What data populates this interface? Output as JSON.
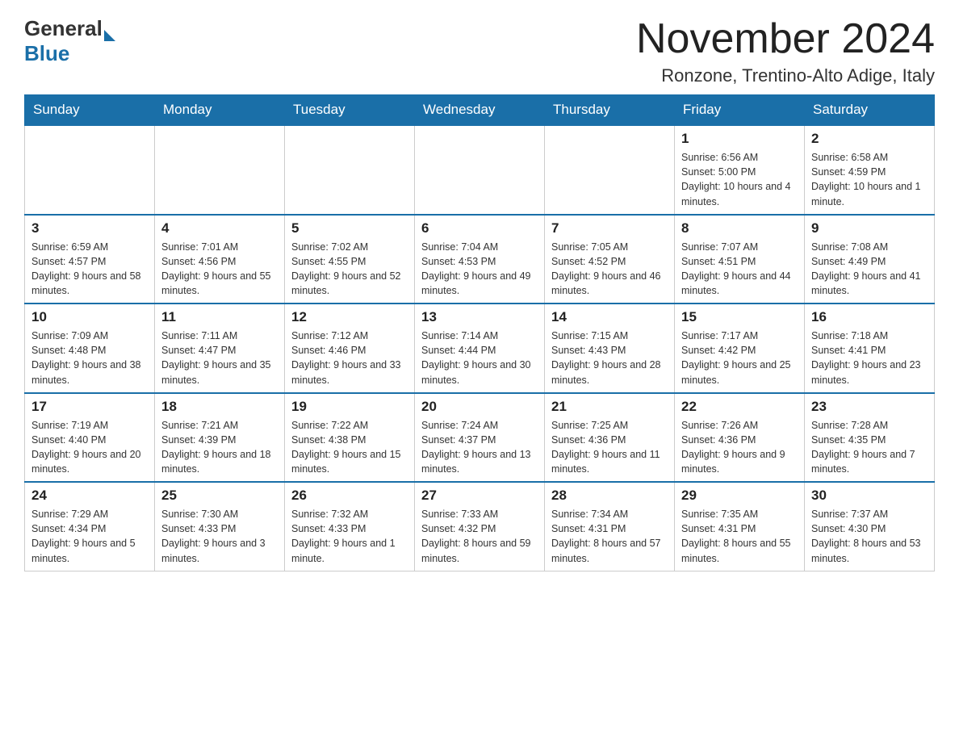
{
  "logo": {
    "general": "General",
    "blue": "Blue"
  },
  "title": "November 2024",
  "location": "Ronzone, Trentino-Alto Adige, Italy",
  "days_of_week": [
    "Sunday",
    "Monday",
    "Tuesday",
    "Wednesday",
    "Thursday",
    "Friday",
    "Saturday"
  ],
  "weeks": [
    [
      {
        "day": "",
        "info": ""
      },
      {
        "day": "",
        "info": ""
      },
      {
        "day": "",
        "info": ""
      },
      {
        "day": "",
        "info": ""
      },
      {
        "day": "",
        "info": ""
      },
      {
        "day": "1",
        "info": "Sunrise: 6:56 AM\nSunset: 5:00 PM\nDaylight: 10 hours and 4 minutes."
      },
      {
        "day": "2",
        "info": "Sunrise: 6:58 AM\nSunset: 4:59 PM\nDaylight: 10 hours and 1 minute."
      }
    ],
    [
      {
        "day": "3",
        "info": "Sunrise: 6:59 AM\nSunset: 4:57 PM\nDaylight: 9 hours and 58 minutes."
      },
      {
        "day": "4",
        "info": "Sunrise: 7:01 AM\nSunset: 4:56 PM\nDaylight: 9 hours and 55 minutes."
      },
      {
        "day": "5",
        "info": "Sunrise: 7:02 AM\nSunset: 4:55 PM\nDaylight: 9 hours and 52 minutes."
      },
      {
        "day": "6",
        "info": "Sunrise: 7:04 AM\nSunset: 4:53 PM\nDaylight: 9 hours and 49 minutes."
      },
      {
        "day": "7",
        "info": "Sunrise: 7:05 AM\nSunset: 4:52 PM\nDaylight: 9 hours and 46 minutes."
      },
      {
        "day": "8",
        "info": "Sunrise: 7:07 AM\nSunset: 4:51 PM\nDaylight: 9 hours and 44 minutes."
      },
      {
        "day": "9",
        "info": "Sunrise: 7:08 AM\nSunset: 4:49 PM\nDaylight: 9 hours and 41 minutes."
      }
    ],
    [
      {
        "day": "10",
        "info": "Sunrise: 7:09 AM\nSunset: 4:48 PM\nDaylight: 9 hours and 38 minutes."
      },
      {
        "day": "11",
        "info": "Sunrise: 7:11 AM\nSunset: 4:47 PM\nDaylight: 9 hours and 35 minutes."
      },
      {
        "day": "12",
        "info": "Sunrise: 7:12 AM\nSunset: 4:46 PM\nDaylight: 9 hours and 33 minutes."
      },
      {
        "day": "13",
        "info": "Sunrise: 7:14 AM\nSunset: 4:44 PM\nDaylight: 9 hours and 30 minutes."
      },
      {
        "day": "14",
        "info": "Sunrise: 7:15 AM\nSunset: 4:43 PM\nDaylight: 9 hours and 28 minutes."
      },
      {
        "day": "15",
        "info": "Sunrise: 7:17 AM\nSunset: 4:42 PM\nDaylight: 9 hours and 25 minutes."
      },
      {
        "day": "16",
        "info": "Sunrise: 7:18 AM\nSunset: 4:41 PM\nDaylight: 9 hours and 23 minutes."
      }
    ],
    [
      {
        "day": "17",
        "info": "Sunrise: 7:19 AM\nSunset: 4:40 PM\nDaylight: 9 hours and 20 minutes."
      },
      {
        "day": "18",
        "info": "Sunrise: 7:21 AM\nSunset: 4:39 PM\nDaylight: 9 hours and 18 minutes."
      },
      {
        "day": "19",
        "info": "Sunrise: 7:22 AM\nSunset: 4:38 PM\nDaylight: 9 hours and 15 minutes."
      },
      {
        "day": "20",
        "info": "Sunrise: 7:24 AM\nSunset: 4:37 PM\nDaylight: 9 hours and 13 minutes."
      },
      {
        "day": "21",
        "info": "Sunrise: 7:25 AM\nSunset: 4:36 PM\nDaylight: 9 hours and 11 minutes."
      },
      {
        "day": "22",
        "info": "Sunrise: 7:26 AM\nSunset: 4:36 PM\nDaylight: 9 hours and 9 minutes."
      },
      {
        "day": "23",
        "info": "Sunrise: 7:28 AM\nSunset: 4:35 PM\nDaylight: 9 hours and 7 minutes."
      }
    ],
    [
      {
        "day": "24",
        "info": "Sunrise: 7:29 AM\nSunset: 4:34 PM\nDaylight: 9 hours and 5 minutes."
      },
      {
        "day": "25",
        "info": "Sunrise: 7:30 AM\nSunset: 4:33 PM\nDaylight: 9 hours and 3 minutes."
      },
      {
        "day": "26",
        "info": "Sunrise: 7:32 AM\nSunset: 4:33 PM\nDaylight: 9 hours and 1 minute."
      },
      {
        "day": "27",
        "info": "Sunrise: 7:33 AM\nSunset: 4:32 PM\nDaylight: 8 hours and 59 minutes."
      },
      {
        "day": "28",
        "info": "Sunrise: 7:34 AM\nSunset: 4:31 PM\nDaylight: 8 hours and 57 minutes."
      },
      {
        "day": "29",
        "info": "Sunrise: 7:35 AM\nSunset: 4:31 PM\nDaylight: 8 hours and 55 minutes."
      },
      {
        "day": "30",
        "info": "Sunrise: 7:37 AM\nSunset: 4:30 PM\nDaylight: 8 hours and 53 minutes."
      }
    ]
  ]
}
